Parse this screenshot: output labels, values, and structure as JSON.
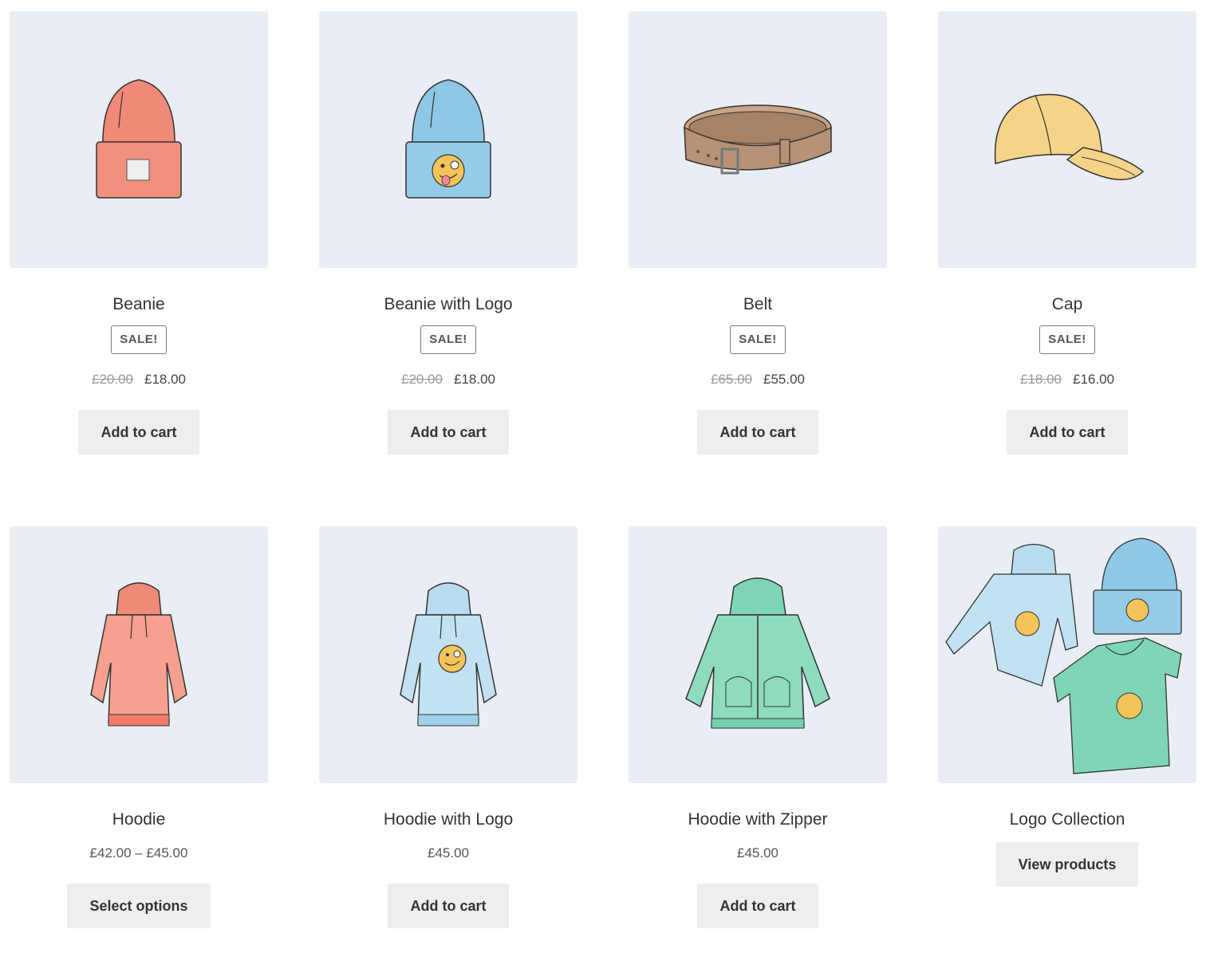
{
  "products": [
    {
      "title": "Beanie",
      "badge": "SALE!",
      "old_price": "£20.00",
      "price": "£18.00",
      "button": "Add to cart",
      "icon": "red-beanie-image"
    },
    {
      "title": "Beanie with Logo",
      "badge": "SALE!",
      "old_price": "£20.00",
      "price": "£18.00",
      "button": "Add to cart",
      "icon": "blue-beanie-logo-image"
    },
    {
      "title": "Belt",
      "badge": "SALE!",
      "old_price": "£65.00",
      "price": "£55.00",
      "button": "Add to cart",
      "icon": "brown-belt-image"
    },
    {
      "title": "Cap",
      "badge": "SALE!",
      "old_price": "£18.00",
      "price": "£16.00",
      "button": "Add to cart",
      "icon": "yellow-cap-image"
    },
    {
      "title": "Hoodie",
      "price": "£42.00 – £45.00",
      "button": "Select options",
      "icon": "red-hoodie-image"
    },
    {
      "title": "Hoodie with Logo",
      "price": "£45.00",
      "button": "Add to cart",
      "icon": "blue-hoodie-logo-image"
    },
    {
      "title": "Hoodie with Zipper",
      "price": "£45.00",
      "button": "Add to cart",
      "icon": "green-zip-hoodie-image"
    },
    {
      "title": "Logo Collection",
      "button": "View products",
      "icon": "logo-collection-image"
    }
  ],
  "colors": {
    "thumb_bg": "#e8eef3",
    "button_bg": "#eeeeee",
    "red": "#f08a78",
    "blue": "#8ec8e6",
    "brown": "#b08a6a",
    "yellow": "#f5d48a",
    "green": "#7fd6b6",
    "emoji": "#f2c45a"
  }
}
